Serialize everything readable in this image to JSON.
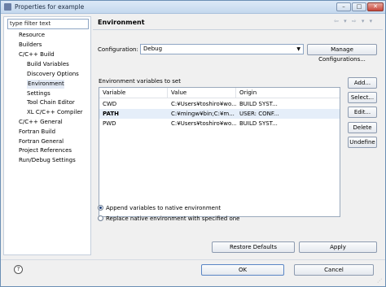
{
  "window": {
    "title": "Properties for example"
  },
  "left": {
    "filter_placeholder": "type filter text",
    "tree": [
      {
        "label": "Resource"
      },
      {
        "label": "Builders"
      },
      {
        "label": "C/C++ Build"
      },
      {
        "label": "Build Variables"
      },
      {
        "label": "Discovery Options"
      },
      {
        "label": "Environment"
      },
      {
        "label": "Settings"
      },
      {
        "label": "Tool Chain Editor"
      },
      {
        "label": "XL C/C++ Compiler"
      },
      {
        "label": "C/C++ General"
      },
      {
        "label": "Fortran Build"
      },
      {
        "label": "Fortran General"
      },
      {
        "label": "Project References"
      },
      {
        "label": "Run/Debug Settings"
      }
    ]
  },
  "page": {
    "title": "Environment",
    "nav_arrows": "⇦ ▾ ⇨ ▾ ▾",
    "configuration_label": "Configuration:",
    "configuration_value": "Debug",
    "manage_button": "Manage Configurations...",
    "env_label": "Environment variables to set",
    "columns": [
      "Variable",
      "Value",
      "Origin"
    ],
    "rows": [
      {
        "variable": "CWD",
        "value": "C:¥Users¥toshiro¥wo...",
        "origin": "BUILD SYST..."
      },
      {
        "variable": "PATH",
        "value": "C:¥mingw¥bin;C:¥m...",
        "origin": "USER: CONF..."
      },
      {
        "variable": "PWD",
        "value": "C:¥Users¥toshiro¥wo...",
        "origin": "BUILD SYST..."
      }
    ],
    "side_buttons": [
      "Add...",
      "Select...",
      "Edit...",
      "Delete",
      "Undefine"
    ],
    "radio_append": "Append variables to native environment",
    "radio_replace": "Replace native environment with specified one",
    "restore_button": "Restore Defaults",
    "apply_button": "Apply"
  },
  "footer": {
    "help": "?",
    "ok": "OK",
    "cancel": "Cancel"
  }
}
